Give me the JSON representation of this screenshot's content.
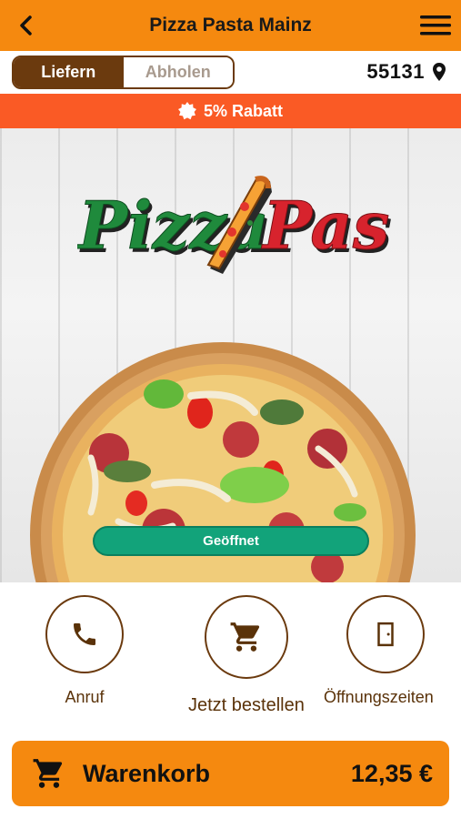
{
  "header": {
    "title": "Pizza Pasta Mainz",
    "back_icon": "chevron-left-icon",
    "menu_icon": "hamburger-icon"
  },
  "mode": {
    "options": [
      "Liefern",
      "Abholen"
    ],
    "selected": "Liefern"
  },
  "location": {
    "zip": "55131",
    "icon": "map-pin-icon"
  },
  "promo": {
    "text": "5% Rabatt",
    "icon": "badge-icon"
  },
  "hero": {
    "logo_word_1": "Pizza",
    "logo_word_2": "Pasta",
    "status": "Geöffnet"
  },
  "actions": [
    {
      "label": "Anruf",
      "icon": "phone-icon"
    },
    {
      "label": "Jetzt bestellen",
      "icon": "cart-icon"
    },
    {
      "label": "Öffnungszeiten",
      "icon": "door-icon"
    }
  ],
  "cart": {
    "label": "Warenkorb",
    "total": "12,35 €",
    "icon": "cart-icon"
  },
  "colors": {
    "primary": "#f5890f",
    "brown": "#6b3a0e",
    "promo": "#fa5a25",
    "open": "#12a37a"
  }
}
